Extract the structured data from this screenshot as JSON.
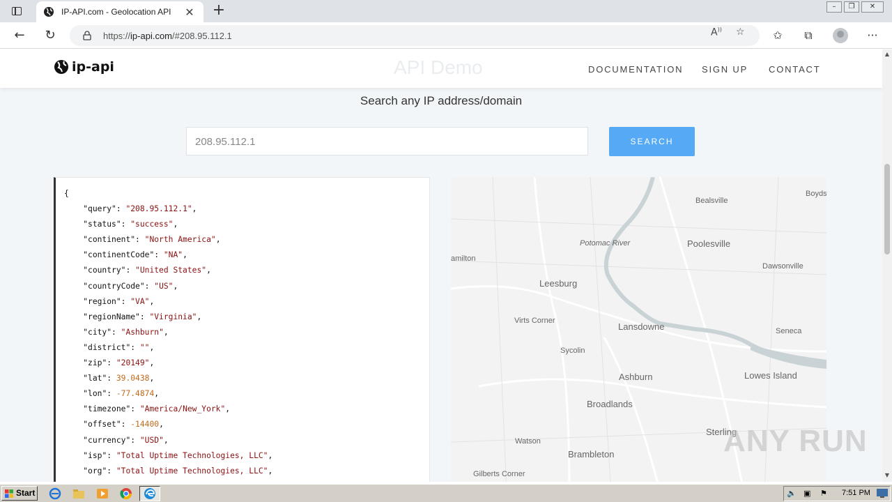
{
  "browser": {
    "tab_title": "IP-API.com - Geolocation API",
    "url_prefix": "https://",
    "url_host": "ip-api.com",
    "url_path": "/#208.95.112.1"
  },
  "site": {
    "logo_text": "ip-api",
    "ghost_title": "API Demo",
    "menu": [
      "DOCUMENTATION",
      "SIGN UP",
      "CONTACT"
    ],
    "subtitle": "Search any IP address/domain",
    "search_value": "208.95.112.1",
    "search_button": "SEARCH"
  },
  "json_lines": [
    {
      "k": "query",
      "v": "\"208.95.112.1\"",
      "t": "str"
    },
    {
      "k": "status",
      "v": "\"success\"",
      "t": "str"
    },
    {
      "k": "continent",
      "v": "\"North America\"",
      "t": "str"
    },
    {
      "k": "continentCode",
      "v": "\"NA\"",
      "t": "str"
    },
    {
      "k": "country",
      "v": "\"United States\"",
      "t": "str"
    },
    {
      "k": "countryCode",
      "v": "\"US\"",
      "t": "str"
    },
    {
      "k": "region",
      "v": "\"VA\"",
      "t": "str"
    },
    {
      "k": "regionName",
      "v": "\"Virginia\"",
      "t": "str"
    },
    {
      "k": "city",
      "v": "\"Ashburn\"",
      "t": "str"
    },
    {
      "k": "district",
      "v": "\"\"",
      "t": "str"
    },
    {
      "k": "zip",
      "v": "\"20149\"",
      "t": "str"
    },
    {
      "k": "lat",
      "v": "39.0438",
      "t": "num"
    },
    {
      "k": "lon",
      "v": "-77.4874",
      "t": "num"
    },
    {
      "k": "timezone",
      "v": "\"America/New_York\"",
      "t": "str"
    },
    {
      "k": "offset",
      "v": "-14400",
      "t": "num"
    },
    {
      "k": "currency",
      "v": "\"USD\"",
      "t": "str"
    },
    {
      "k": "isp",
      "v": "\"Total Uptime Technologies, LLC\"",
      "t": "str"
    },
    {
      "k": "org",
      "v": "\"Total Uptime Technologies, LLC\"",
      "t": "str"
    }
  ],
  "map_labels": [
    {
      "text": "Bealsville",
      "size": 11
    },
    {
      "text": "Boyds",
      "size": 11
    },
    {
      "text": "Potomac River",
      "size": 11,
      "italic": true
    },
    {
      "text": "Poolesville",
      "size": 13
    },
    {
      "text": "amilton",
      "size": 11
    },
    {
      "text": "Dawsonville",
      "size": 11
    },
    {
      "text": "Leesburg",
      "size": 13
    },
    {
      "text": "Virts Corner",
      "size": 11
    },
    {
      "text": "Lansdowne",
      "size": 13
    },
    {
      "text": "Seneca",
      "size": 11
    },
    {
      "text": "Sycolin",
      "size": 11
    },
    {
      "text": "Ashburn",
      "size": 13
    },
    {
      "text": "Lowes Island",
      "size": 13
    },
    {
      "text": "Broadlands",
      "size": 13
    },
    {
      "text": "Sterling",
      "size": 13
    },
    {
      "text": "Watson",
      "size": 11
    },
    {
      "text": "Brambleton",
      "size": 13
    },
    {
      "text": "Gilberts Corner",
      "size": 11
    }
  ],
  "watermark": "ANY RUN",
  "taskbar": {
    "start_label": "Start",
    "clock": "7:51 PM"
  }
}
